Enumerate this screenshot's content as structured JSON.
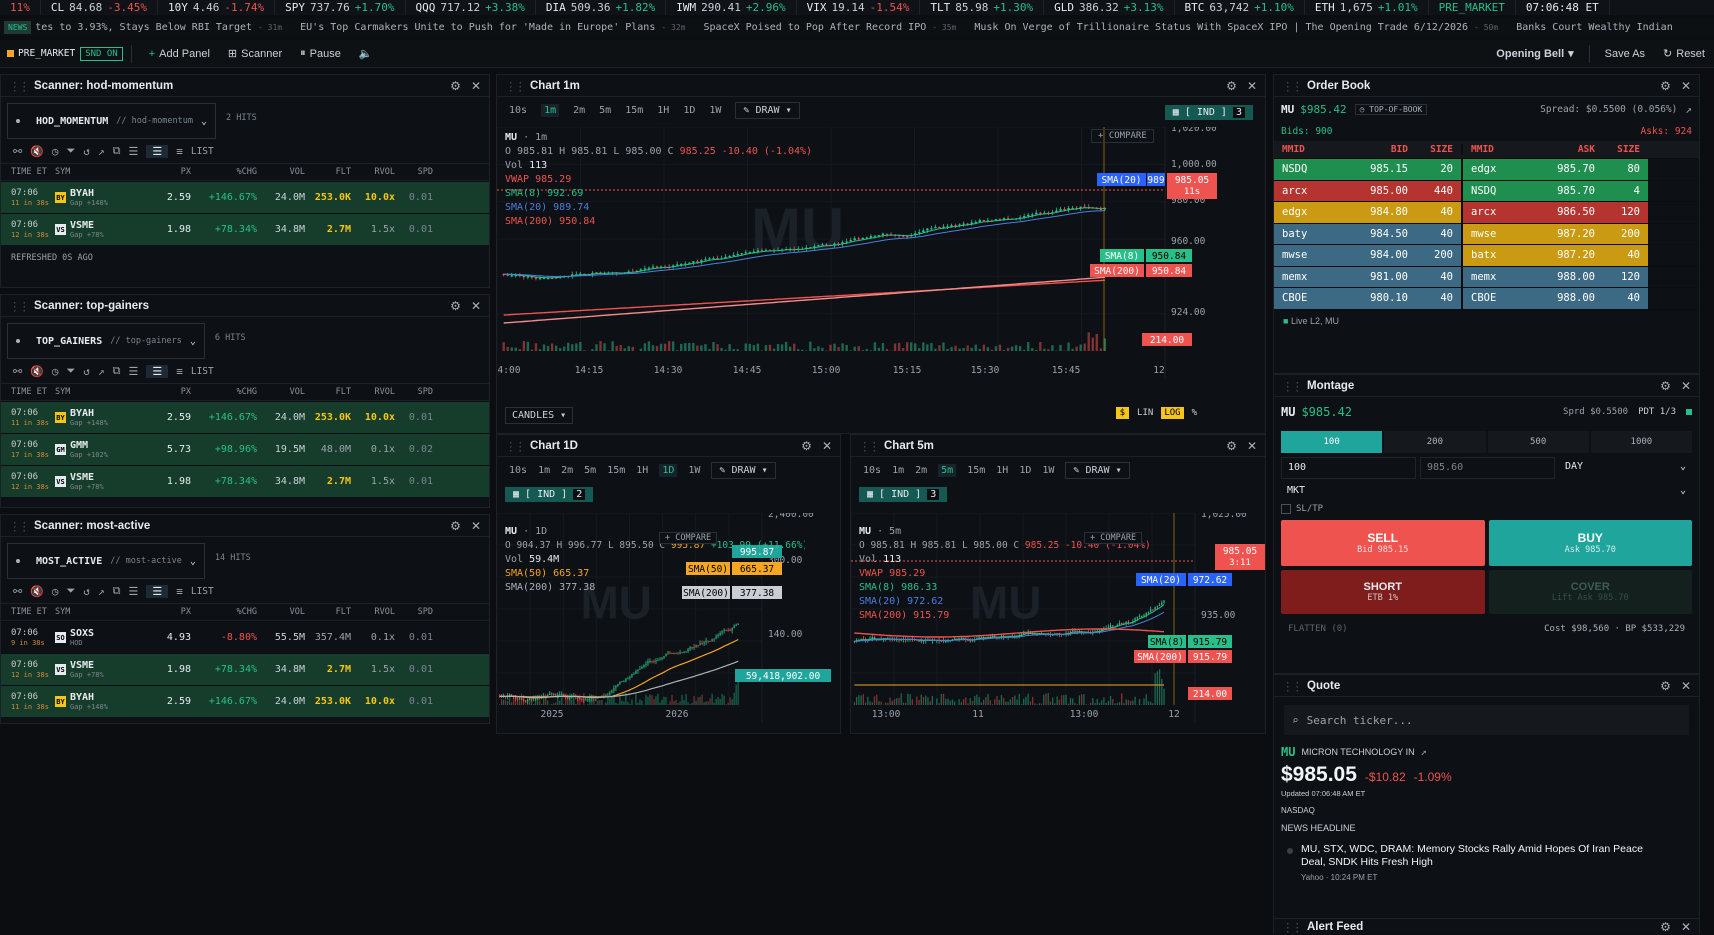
{
  "ticker": [
    {
      "sym": "",
      "val": "11%",
      "chg": "",
      "dir": "dn"
    },
    {
      "sym": "CL",
      "val": "84.68",
      "chg": "-3.45%",
      "dir": "dn"
    },
    {
      "sym": "10Y",
      "val": "4.46",
      "chg": "-1.74%",
      "dir": "dn"
    },
    {
      "sym": "SPY",
      "val": "737.76",
      "chg": "+1.70%",
      "dir": "up"
    },
    {
      "sym": "QQQ",
      "val": "717.12",
      "chg": "+3.38%",
      "dir": "up"
    },
    {
      "sym": "DIA",
      "val": "509.36",
      "chg": "+1.82%",
      "dir": "up"
    },
    {
      "sym": "IWM",
      "val": "290.41",
      "chg": "+2.96%",
      "dir": "up"
    },
    {
      "sym": "VIX",
      "val": "19.14",
      "chg": "-1.54%",
      "dir": "dn"
    },
    {
      "sym": "TLT",
      "val": "85.98",
      "chg": "+1.30%",
      "dir": "up"
    },
    {
      "sym": "GLD",
      "val": "386.32",
      "chg": "+3.13%",
      "dir": "up"
    },
    {
      "sym": "BTC",
      "val": "63,742",
      "chg": "+1.10%",
      "dir": "up"
    },
    {
      "sym": "ETH",
      "val": "1,675",
      "chg": "+1.01%",
      "dir": "up"
    }
  ],
  "session": "PRE_MARKET",
  "clock": "07:06:48 ET",
  "news": {
    "tag": "NEWS",
    "items": [
      {
        "text": "tes to 3.93%, Stays Below RBI Target",
        "ago": "- 31m"
      },
      {
        "text": "EU's Top Carmakers Unite to Push for 'Made in Europe' Plans",
        "ago": "- 32m"
      },
      {
        "text": "SpaceX Poised to Pop After Record IPO",
        "ago": "- 35m"
      },
      {
        "text": "Musk On Verge of Trillionaire Status With SpaceX IPO | The Opening Trade 6/12/2026",
        "ago": "- 50m"
      },
      {
        "text": "Banks Court Wealthy Indian",
        "ago": ""
      }
    ]
  },
  "toolbar": {
    "session": "PRE_MARKET",
    "snd": "SND ON",
    "add": "Add Panel",
    "scanner": "Scanner",
    "pause": "Pause",
    "layout": "Opening Bell",
    "saveas": "Save As",
    "reset": "Reset"
  },
  "scan_cols": [
    "TIME ET",
    "SYM",
    "PX",
    "%CHG",
    "VOL",
    "FLT",
    "RVOL",
    "SPD"
  ],
  "scanners": [
    {
      "title": "Scanner: hod-momentum",
      "id": "HOD_MOMENTUM",
      "slug": "// hod-momentum",
      "hits": "2 HITS",
      "list": "LIST",
      "footer": "REFRESHED 0S AGO",
      "rows": [
        {
          "time": "07:06",
          "ago": "11 in 38s",
          "logo": "BY",
          "sym": "BYAH",
          "sub": "Gap +148%",
          "px": "2.59",
          "chg": "+146.67%",
          "vol": "24.0M",
          "flt": "253.0K",
          "rvol": "10.0x",
          "spd": "0.01"
        },
        {
          "time": "07:06",
          "ago": "12 in 38s",
          "logo": "VS",
          "sym": "VSME",
          "sub": "Gap +78%",
          "px": "1.98",
          "chg": "+78.34%",
          "vol": "34.8M",
          "flt": "2.7M",
          "rvol": "1.5x",
          "spd": "0.01"
        }
      ]
    },
    {
      "title": "Scanner: top-gainers",
      "id": "TOP_GAINERS",
      "slug": "// top-gainers",
      "hits": "6 HITS",
      "list": "LIST",
      "rows": [
        {
          "time": "07:06",
          "ago": "11 in 38s",
          "logo": "BY",
          "sym": "BYAH",
          "sub": "Gap +148%",
          "px": "2.59",
          "chg": "+146.67%",
          "vol": "24.0M",
          "flt": "253.0K",
          "rvol": "10.0x",
          "spd": "0.01"
        },
        {
          "time": "07:06",
          "ago": "17 in 38s",
          "logo": "GM",
          "sym": "GMM",
          "sub": "Gap +102%",
          "px": "5.73",
          "chg": "+98.96%",
          "vol": "19.5M",
          "flt": "48.0M",
          "rvol": "0.1x",
          "spd": "0.02"
        },
        {
          "time": "07:06",
          "ago": "12 in 38s",
          "logo": "VS",
          "sym": "VSME",
          "sub": "Gap +78%",
          "px": "1.98",
          "chg": "+78.34%",
          "vol": "34.8M",
          "flt": "2.7M",
          "rvol": "1.5x",
          "spd": "0.01"
        }
      ]
    },
    {
      "title": "Scanner: most-active",
      "id": "MOST_ACTIVE",
      "slug": "// most-active",
      "hits": "14 HITS",
      "list": "LIST",
      "rows": [
        {
          "time": "07:06",
          "ago": "9 in 38s",
          "logo": "SO",
          "sym": "SOXS",
          "sub": "HOD",
          "px": "4.93",
          "chg": "-8.80%",
          "vol": "55.5M",
          "flt": "357.4M",
          "rvol": "0.1x",
          "spd": "0.01"
        },
        {
          "time": "07:06",
          "ago": "12 in 38s",
          "logo": "VS",
          "sym": "VSME",
          "sub": "Gap +78%",
          "px": "1.98",
          "chg": "+78.34%",
          "vol": "34.8M",
          "flt": "2.7M",
          "rvol": "1.5x",
          "spd": "0.01"
        },
        {
          "time": "07:06",
          "ago": "11 in 38s",
          "logo": "BY",
          "sym": "BYAH",
          "sub": "Gap +148%",
          "px": "2.59",
          "chg": "+146.67%",
          "vol": "24.0M",
          "flt": "253.0K",
          "rvol": "10.0x",
          "spd": "0.01"
        }
      ]
    }
  ],
  "chart1m": {
    "title": "Chart 1m",
    "tfs": [
      "10s",
      "1m",
      "2m",
      "5m",
      "15m",
      "1H",
      "1D",
      "1W"
    ],
    "active": "1m",
    "draw": "DRAW",
    "ind": "[ IND ]",
    "indn": "3",
    "sym": "MU",
    "tf": "· 1m",
    "ohlc": "O 985.81 H 985.81 L 985.00 C",
    "close": "985.25",
    "chg": "-10.40 (-1.04%)",
    "vol": "113",
    "vwap": "VWAP 985.29",
    "sma8": "SMA(8) 992.69",
    "sma20": "SMA(20) 989.74",
    "sma200": "SMA(200) 950.84",
    "compare": "COMPARE",
    "yticks": [
      "1,020.00",
      "1,000.00",
      "980.00",
      "960.00",
      "924.00"
    ],
    "xticks": [
      "4:00",
      "14:15",
      "14:30",
      "14:45",
      "15:00",
      "15:15",
      "15:30",
      "15:45",
      "12"
    ],
    "tags": {
      "sma20": "SMA(20)",
      "sma20v": "989",
      "last": "985.05",
      "cd": "11s",
      "sma8": "SMA(8)",
      "sma8v": "950.84",
      "sma200": "SMA(200)",
      "sma200v": "950.84",
      "volv": "214.00"
    },
    "ctype": "CANDLES",
    "scale": [
      "$",
      "LIN",
      "LOG",
      "%"
    ],
    "watermark": "MU"
  },
  "chart1d": {
    "title": "Chart 1D",
    "tfs": [
      "10s",
      "1m",
      "2m",
      "5m",
      "15m",
      "1H",
      "1D",
      "1W"
    ],
    "active": "1D",
    "draw": "DRAW",
    "ind": "[ IND ]",
    "indn": "2",
    "sym": "MU",
    "tf": "· 1D",
    "ohlc": "O 904.37 H 996.77 L 895.50 C",
    "close": "995.87",
    "chg": "+103.99 (+11.66%)",
    "vol": "59.4M",
    "sma50": "SMA(50) 665.37",
    "sma200": "SMA(200) 377.38",
    "compare": "COMPARE",
    "yticks": [
      "2,400.00",
      "300.00",
      "140.00"
    ],
    "xticks": [
      "2025",
      "2026"
    ],
    "tags": {
      "last": "995.87",
      "sma50": "SMA(50)",
      "sma50v": "665.37",
      "sma200": "SMA(200)",
      "sma200v": "377.38",
      "volv": "59,418,902.00"
    },
    "watermark": "MU"
  },
  "chart5m": {
    "title": "Chart 5m",
    "tfs": [
      "10s",
      "1m",
      "2m",
      "5m",
      "15m",
      "1H",
      "1D",
      "1W"
    ],
    "active": "5m",
    "draw": "DRAW",
    "ind": "[ IND ]",
    "indn": "3",
    "sym": "MU",
    "tf": "· 5m",
    "ohlc": "O 985.81 H 985.81 L 985.00 C",
    "close": "985.25",
    "chg": "-10.40 (-1.04%)",
    "vol": "113",
    "vwap": "VWAP 985.29",
    "sma8": "SMA(8) 986.33",
    "sma20": "SMA(20) 972.62",
    "sma200": "SMA(200) 915.79",
    "compare": "COMPARE",
    "yticks": [
      "1,025.00",
      "935.00"
    ],
    "xticks": [
      "13:00",
      "11",
      "13:00",
      "12"
    ],
    "tags": {
      "last": "985.05",
      "cd": "3:11",
      "sma20": "SMA(20)",
      "sma20v": "972.62",
      "sma8": "SMA(8)",
      "sma8v": "915.79",
      "sma200": "SMA(200)",
      "sma200v": "915.79",
      "volv": "214.00"
    },
    "watermark": "MU"
  },
  "orderbook": {
    "title": "Order Book",
    "sym": "MU",
    "price": "$985.42",
    "tob": "TOP-OF-BOOK",
    "spread": "Spread: $0.5500 (0.056%)",
    "bids": "Bids: 900",
    "asks": "Asks: 924",
    "cols": [
      "MMID",
      "BID",
      "SIZE",
      "MMID",
      "ASK",
      "SIZE"
    ],
    "rows": [
      {
        "bm": "NSDQ",
        "bp": "985.15",
        "bs": "20",
        "am": "edgx",
        "ap": "985.70",
        "as": "80",
        "bc": "#1e8f4e",
        "ac": "#1e8f4e"
      },
      {
        "bm": "arcx",
        "bp": "985.00",
        "bs": "440",
        "am": "NSDQ",
        "ap": "985.70",
        "as": "4",
        "bc": "#b5342f",
        "ac": "#1e8f4e"
      },
      {
        "bm": "edgx",
        "bp": "984.80",
        "bs": "40",
        "am": "arcx",
        "ap": "986.50",
        "as": "120",
        "bc": "#c99a12",
        "ac": "#b5342f"
      },
      {
        "bm": "baty",
        "bp": "984.50",
        "bs": "40",
        "am": "mwse",
        "ap": "987.20",
        "as": "200",
        "bc": "#3c6a84",
        "ac": "#c99a12"
      },
      {
        "bm": "mwse",
        "bp": "984.00",
        "bs": "200",
        "am": "batx",
        "ap": "987.20",
        "as": "40",
        "bc": "#3c6a84",
        "ac": "#c99a12"
      },
      {
        "bm": "memx",
        "bp": "981.00",
        "bs": "40",
        "am": "memx",
        "ap": "988.00",
        "as": "120",
        "bc": "#3c6a84",
        "ac": "#3c6a84"
      },
      {
        "bm": "CBOE",
        "bp": "980.10",
        "bs": "40",
        "am": "CBOE",
        "ap": "988.00",
        "as": "40",
        "bc": "#3c6a84",
        "ac": "#3c6a84"
      }
    ],
    "footer": "Live L2, MU"
  },
  "montage": {
    "title": "Montage",
    "sym": "MU",
    "price": "$985.42",
    "sprd": "Sprd $0.5500",
    "pdt": "PDT 1/3",
    "qtys": [
      "100",
      "200",
      "500",
      "1000"
    ],
    "qty": "100",
    "limit": "985.60",
    "tif": "DAY",
    "otype": "MKT",
    "sltp": "SL/TP",
    "sell": "SELL",
    "sellsub": "Bid 985.15",
    "buy": "BUY",
    "buysub": "Ask 985.70",
    "short": "SHORT",
    "shortsub": "ETB 1%",
    "cover": "COVER",
    "coversub": "Lift Ask 985.70",
    "flatten": "FLATTEN (0)",
    "cost": "Cost $98,560 · BP $533,229"
  },
  "quote": {
    "title": "Quote",
    "placeholder": "Search ticker...",
    "sym": "MU",
    "name": "MICRON TECHNOLOGY IN",
    "price": "$985.05",
    "chg": "-$10.82",
    "pct": "-1.09%",
    "updated": "Updated 07:06:48 AM ET",
    "exch": "NASDAQ",
    "nh": "NEWS HEADLINE",
    "headline": "MU, STX, WDC, DRAM: Memory Stocks Rally Amid Hopes Of Iran Peace Deal, SNDK Hits Fresh High",
    "src": "Yahoo · 10:24 PM ET"
  },
  "alert": {
    "title": "Alert Feed"
  },
  "colors": {
    "up": "#27c08a",
    "down": "#ef5350",
    "accent": "#145a52",
    "yellow": "#f5c518"
  }
}
